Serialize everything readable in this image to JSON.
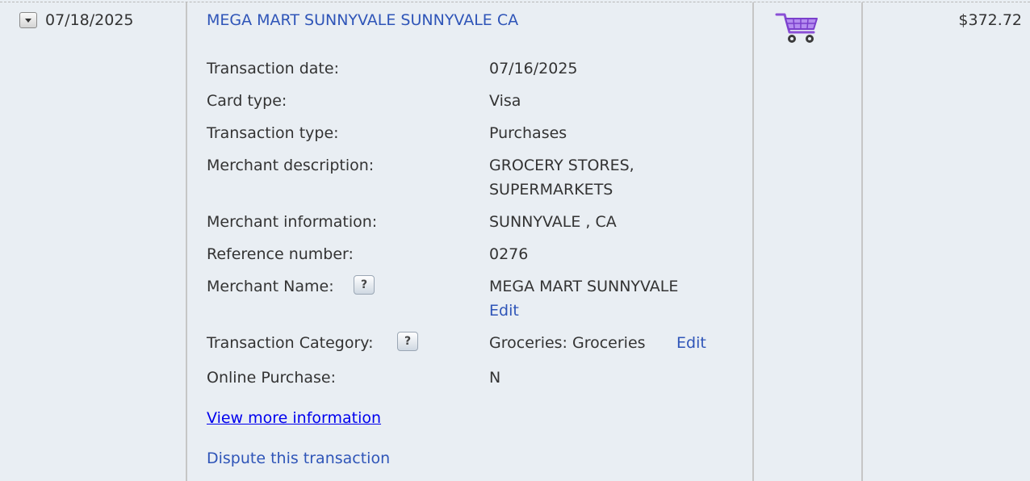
{
  "transaction": {
    "post_date": "07/18/2025",
    "merchant_title": "MEGA MART SUNNYVALE SUNNYVALE CA",
    "amount": "$372.72",
    "category_icon": "shopping-cart-icon"
  },
  "details": {
    "transaction_date": {
      "label": "Transaction date:",
      "value": "07/16/2025"
    },
    "card_type": {
      "label": "Card type:",
      "value": "Visa"
    },
    "transaction_type": {
      "label": "Transaction type:",
      "value": "Purchases"
    },
    "merchant_description": {
      "label": "Merchant description:",
      "value_line1": "GROCERY STORES,",
      "value_line2": "SUPERMARKETS"
    },
    "merchant_information": {
      "label": "Merchant information:",
      "value": "SUNNYVALE , CA"
    },
    "reference_number": {
      "label": "Reference number:",
      "value": "0276"
    },
    "merchant_name": {
      "label": "Merchant Name:",
      "value": "MEGA MART SUNNYVALE",
      "edit": "Edit"
    },
    "transaction_category": {
      "label": "Transaction Category:",
      "value": "Groceries: Groceries",
      "edit": "Edit"
    },
    "online_purchase": {
      "label": "Online Purchase:",
      "value": "N"
    }
  },
  "help_glyph": "?",
  "links": {
    "view_more": "View more information",
    "dispute": "Dispute this transaction"
  },
  "colors": {
    "background": "#e9eef3",
    "link": "#2f55b8",
    "underlined_link": "#0000ee",
    "cart": "#8a4fd6"
  }
}
